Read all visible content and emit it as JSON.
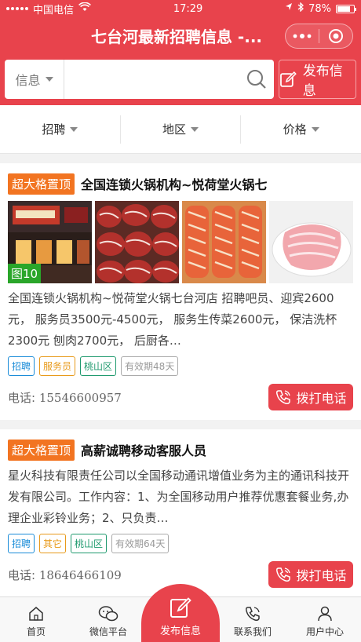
{
  "status": {
    "carrier": "中国电信",
    "time": "17:29",
    "battery": "78%",
    "battery_level": 0.78
  },
  "header": {
    "title": "七台河最新招聘信息 -..."
  },
  "search": {
    "category": "信息",
    "placeholder": "",
    "publish_label": "发布信息"
  },
  "filters": [
    {
      "label": "招聘"
    },
    {
      "label": "地区"
    },
    {
      "label": "价格"
    }
  ],
  "listings": [
    {
      "badge": "超大格置顶",
      "title": "全国连锁火锅机构~悦荷堂火锅七",
      "photo_count": "图10",
      "description": "全国连锁火锅机构~悦荷堂火锅七台河店 招聘吧员、迎宾2600元， 服务员3500元-4500元， 服务生传菜2600元， 保洁洗杯2300元  刨肉2700元， 后厨各…",
      "tags": [
        "招聘",
        "服务员",
        "桃山区",
        "有效期48天"
      ],
      "phone_label": "电话:",
      "phone": "15546600957",
      "call_label": "拨打电话"
    },
    {
      "badge": "超大格置顶",
      "title": "高薪诚聘移动客服人员",
      "description": "星火科技有限责任公司以全国移动通讯增值业务为主的通讯科技开发有限公司。工作内容：1、为全国移动用户推荐优惠套餐业务,办理企业彩铃业务；2、只负责…",
      "tags": [
        "招聘",
        "其它",
        "桃山区",
        "有效期64天"
      ],
      "phone_label": "电话:",
      "phone": "18646466109",
      "call_label": "拨打电话"
    }
  ],
  "tabbar": {
    "home": "首页",
    "wechat": "微信平台",
    "publish": "发布信息",
    "contact": "联系我们",
    "user": "用户中心"
  },
  "colors": {
    "brand": "#e8434c",
    "badge": "#f27421",
    "photo_count": "#2aa62a"
  }
}
